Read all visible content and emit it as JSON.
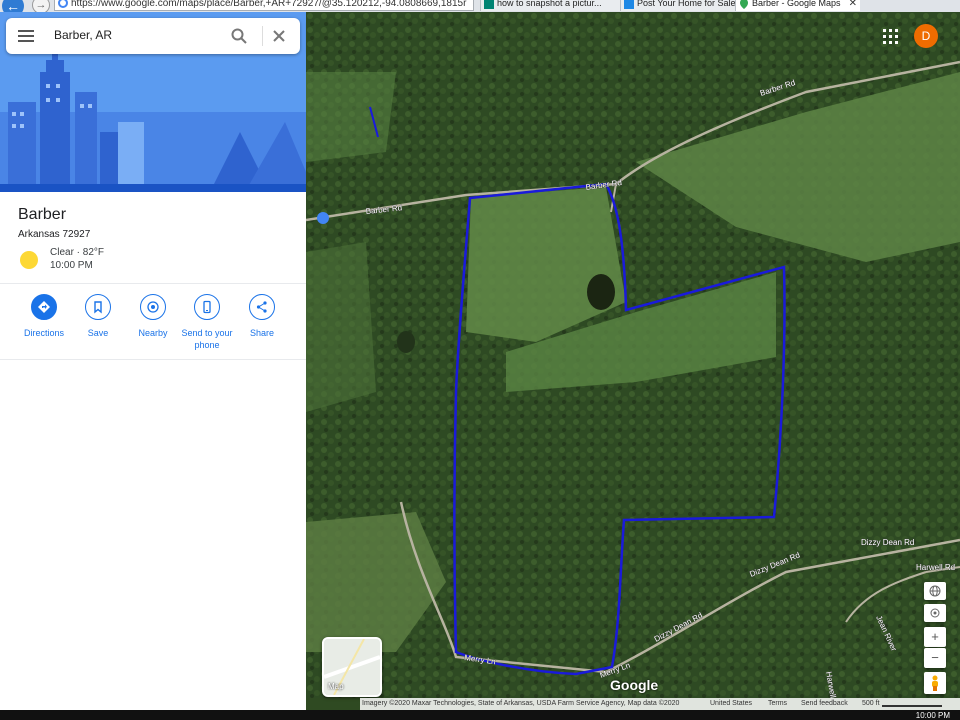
{
  "browser": {
    "url": "https://www.google.com/maps/place/Barber,+AR+72927/@35.120212,-94.0808669,1815r",
    "tabs": [
      {
        "label": "how to snapshot a pictur..."
      },
      {
        "label": "Post Your Home for Sale ..."
      },
      {
        "label": "Barber - Google Maps"
      }
    ]
  },
  "search": {
    "value": "Barber, AR"
  },
  "place": {
    "title": "Barber",
    "subtitle": "Arkansas 72927",
    "weather_condition": "Clear · 82°F",
    "weather_time": "10:00 PM"
  },
  "actions": [
    {
      "label": "Directions"
    },
    {
      "label": "Save"
    },
    {
      "label": "Nearby"
    },
    {
      "label": "Send to your phone"
    },
    {
      "label": "Share"
    }
  ],
  "map": {
    "road_labels": [
      "Barber Rd",
      "Barber Rd",
      "Barber Rd",
      "Dizzy Dean Rd",
      "Dizzy Dean Rd",
      "Dizzy Dean Rd",
      "Harwell Rd",
      "Harwell Rd",
      "Merry Ln",
      "Merry Ln",
      "Jean River"
    ],
    "layer_label": "Map",
    "logo": "Google",
    "account_initial": "D",
    "zoom_in": "+",
    "zoom_out": "−",
    "boundary_color": "#1a1adb"
  },
  "footer": {
    "imagery": "Imagery ©2020 Maxar Technologies, State of Arkansas, USDA Farm Service Agency, Map data ©2020",
    "region": "United States",
    "terms": "Terms",
    "feedback": "Send feedback",
    "scale": "500 ft"
  },
  "taskbar": {
    "time": "10:00 PM"
  }
}
